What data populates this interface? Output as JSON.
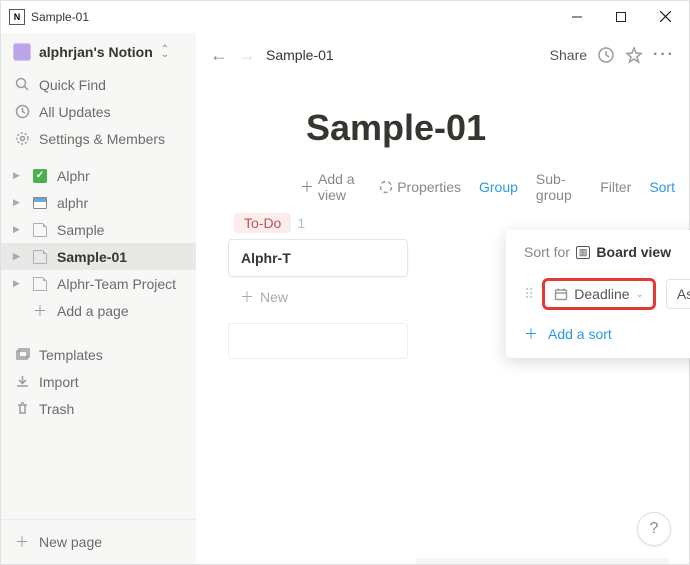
{
  "window": {
    "title": "Sample-01",
    "icon": "N"
  },
  "sidebar": {
    "workspace": "alphrjan's Notion",
    "quickfind": "Quick Find",
    "allupdates": "All Updates",
    "settings": "Settings & Members",
    "pages": [
      {
        "label": "Alphr",
        "icon": "check"
      },
      {
        "label": "alphr",
        "icon": "doc"
      },
      {
        "label": "Sample",
        "icon": "page"
      },
      {
        "label": "Sample-01",
        "icon": "page",
        "selected": true
      },
      {
        "label": "Alphr-Team Project",
        "icon": "page"
      }
    ],
    "addpage_inline": "Add a page",
    "templates": "Templates",
    "import": "Import",
    "trash": "Trash",
    "newpage": "New page"
  },
  "topbar": {
    "breadcrumb": "Sample-01",
    "share": "Share"
  },
  "page": {
    "title": "Sample-01"
  },
  "toolbar": {
    "addview": "Add a view",
    "properties": "Properties",
    "group": "Group",
    "subgroup": "Sub-group",
    "filter": "Filter",
    "sort": "Sort"
  },
  "board": {
    "column_label": "To-Do",
    "column_count": "1",
    "card1": "Alphr-T",
    "new": "New"
  },
  "sort_popover": {
    "prefix": "Sort for",
    "view_name": "Board view",
    "field": "Deadline",
    "order": "Ascending",
    "add": "Add a sort"
  },
  "fab": "?"
}
